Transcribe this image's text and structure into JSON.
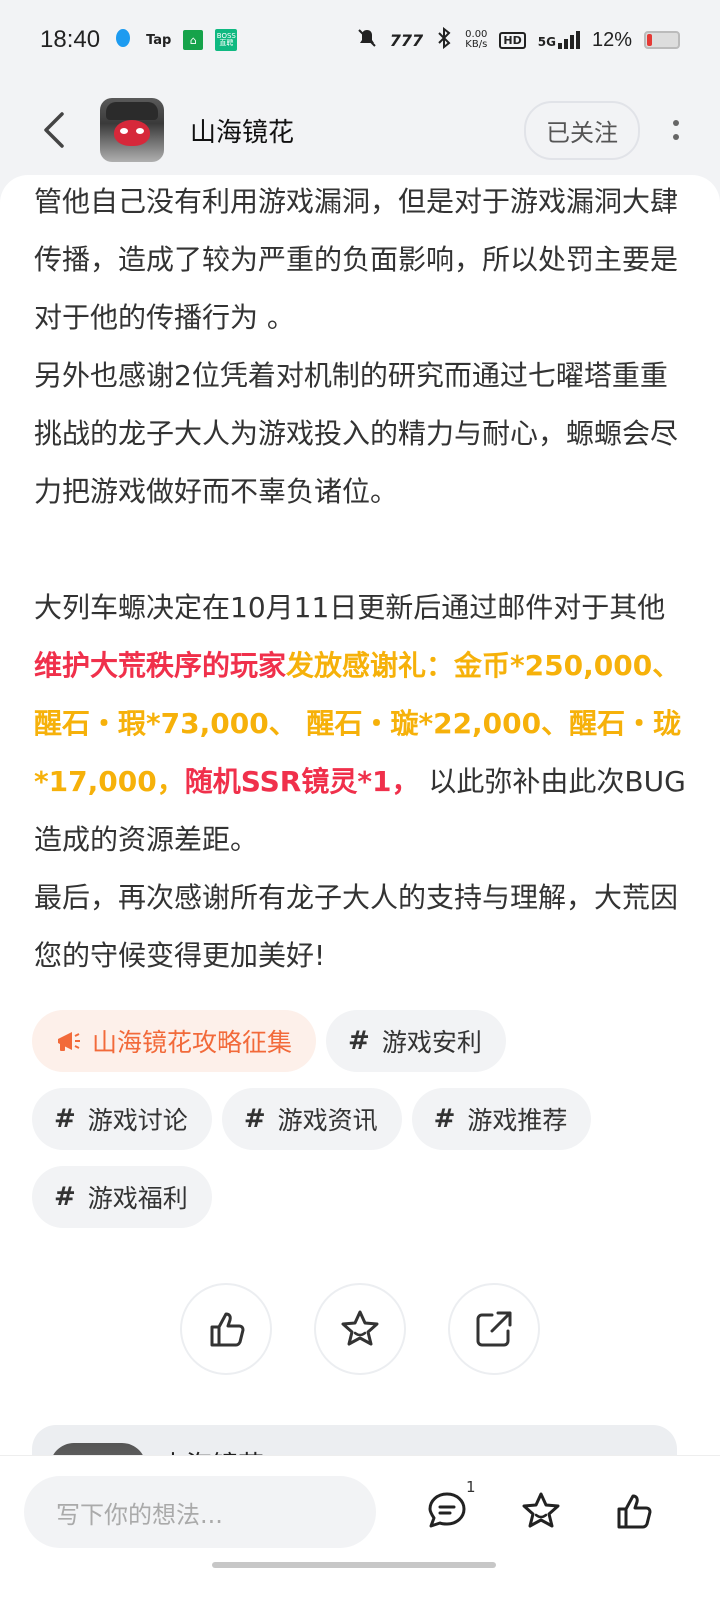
{
  "status_bar": {
    "time": "18:40",
    "tap_label": "Tap",
    "boss_label": "BOSS\n直聘",
    "net_speed": "0.00\nKB/s",
    "hd_label": "HD",
    "signal_label": "5G",
    "battery_pct": "12%",
    "battery_level": 0.12,
    "battery_color": "#e53935"
  },
  "header": {
    "title": "山海镜花",
    "follow_label": "已关注"
  },
  "article": {
    "p1": "管他自己没有利用游戏漏洞，但是对于游戏漏洞大肆传播，造成了较为严重的负面影响，所以处罚主要是对于他的传播行为 。",
    "p2": "另外也感谢2位凭着对机制的研究而通过七曜塔重重挑战的龙子大人为游戏投入的精力与耐心，螈螈会尽力把游戏做好而不辜负诸位。",
    "p3_start": "大列车螈决定在10月11日更新后通过邮件对于其他",
    "p3_red1": "维护大荒秩序的玩家",
    "p3_gold": "发放感谢礼：金币*250,000、醒石・瑕*73,000、 醒石・璇*22,000、醒石・珑*17,000，",
    "p3_red2": "随机SSR镜灵*1，",
    "p3_end": " 以此弥补由此次BUG造成的资源差距。",
    "p4": "最后，再次感谢所有龙子大人的支持与理解，大荒因您的守候变得更加美好!"
  },
  "tags": [
    {
      "label": "山海镜花攻略征集",
      "type": "featured"
    },
    {
      "label": "游戏安利",
      "type": "hash"
    },
    {
      "label": "游戏讨论",
      "type": "hash"
    },
    {
      "label": "游戏资讯",
      "type": "hash"
    },
    {
      "label": "游戏推荐",
      "type": "hash"
    },
    {
      "label": "游戏福利",
      "type": "hash"
    }
  ],
  "next_card": {
    "name": "山海镜花"
  },
  "bottom_bar": {
    "comment_placeholder": "写下你的想法...",
    "comment_count": "1"
  },
  "colors": {
    "red_highlight": "#f0304b",
    "gold_highlight": "#f6b10a",
    "featured_tag": "#f26a3a"
  }
}
